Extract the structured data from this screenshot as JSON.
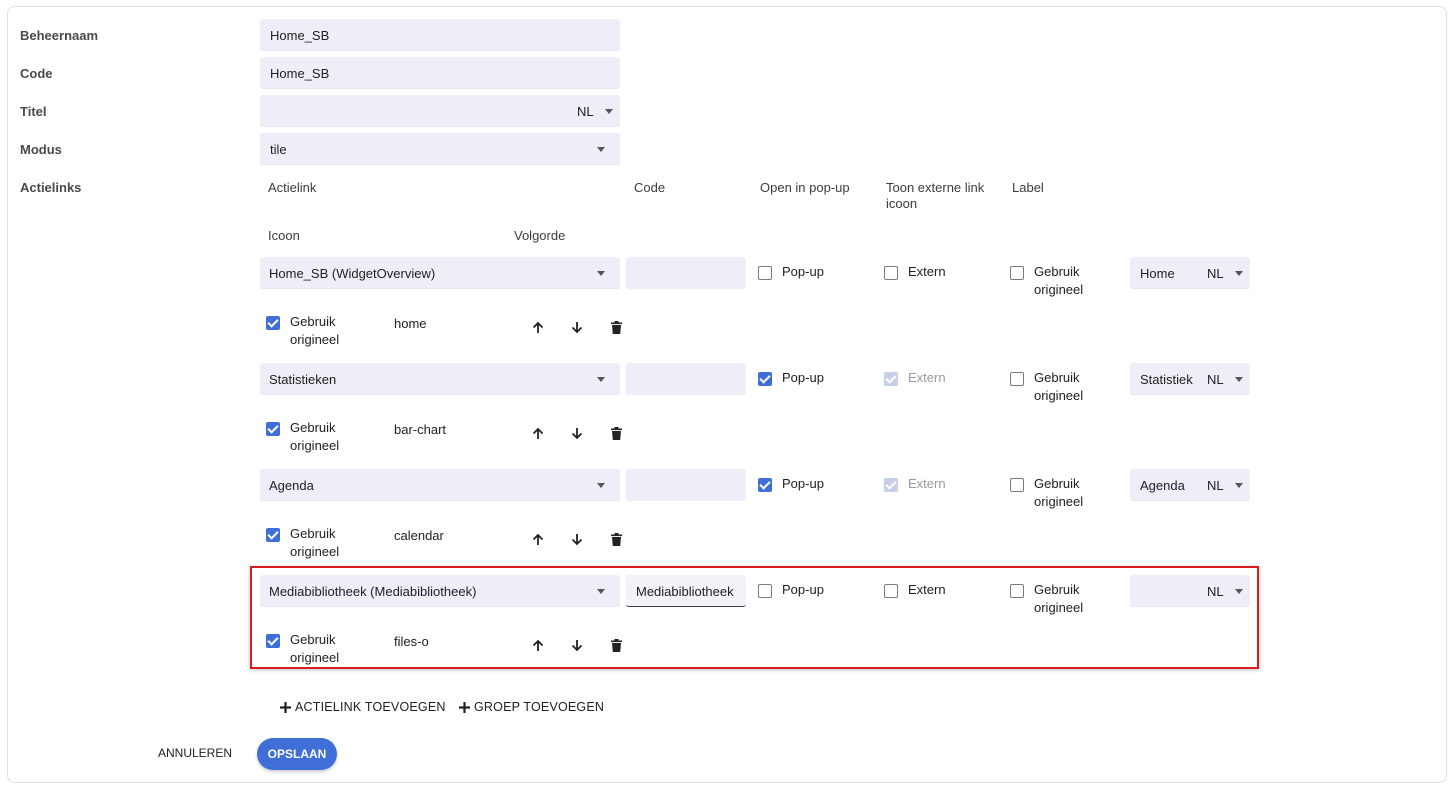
{
  "form": {
    "beheernaam": {
      "label": "Beheernaam",
      "value": "Home_SB"
    },
    "code": {
      "label": "Code",
      "value": "Home_SB"
    },
    "titel": {
      "label": "Titel",
      "value": "",
      "lang": "NL"
    },
    "modus": {
      "label": "Modus",
      "value": "tile"
    },
    "actielinks_label": "Actielinks"
  },
  "columns": {
    "actielink": "Actielink",
    "code": "Code",
    "popup": "Open in pop-up",
    "extern": "Toon externe link icoon",
    "label": "Label",
    "icoon": "Icoon",
    "volgorde": "Volgorde"
  },
  "rows": [
    {
      "actielink": "Home_SB (WidgetOverview)",
      "code": "",
      "popup_label": "Pop-up",
      "popup_checked": false,
      "extern_label": "Extern",
      "extern_checked": false,
      "extern_disabled": false,
      "label_use_original": "Gebruik origineel",
      "label_use_original_checked": false,
      "label_value": "Home",
      "label_lang": "NL",
      "icon_use_original": "Gebruik origineel",
      "icon_use_original_checked": true,
      "icon_value": "home"
    },
    {
      "actielink": "Statistieken",
      "code": "",
      "popup_label": "Pop-up",
      "popup_checked": true,
      "extern_label": "Extern",
      "extern_checked": true,
      "extern_disabled": true,
      "label_use_original": "Gebruik origineel",
      "label_use_original_checked": false,
      "label_value": "Statistiek",
      "label_lang": "NL",
      "icon_use_original": "Gebruik origineel",
      "icon_use_original_checked": true,
      "icon_value": "bar-chart"
    },
    {
      "actielink": "Agenda",
      "code": "",
      "popup_label": "Pop-up",
      "popup_checked": true,
      "extern_label": "Extern",
      "extern_checked": true,
      "extern_disabled": true,
      "label_use_original": "Gebruik origineel",
      "label_use_original_checked": false,
      "label_value": "Agenda",
      "label_lang": "NL",
      "icon_use_original": "Gebruik origineel",
      "icon_use_original_checked": true,
      "icon_value": "calendar"
    },
    {
      "actielink": "Mediabibliotheek (Mediabibliotheek)",
      "code": "Mediabibliotheek",
      "popup_label": "Pop-up",
      "popup_checked": false,
      "extern_label": "Extern",
      "extern_checked": false,
      "extern_disabled": false,
      "label_use_original": "Gebruik origineel",
      "label_use_original_checked": false,
      "label_value": "",
      "label_lang": "NL",
      "icon_use_original": "Gebruik origineel",
      "icon_use_original_checked": true,
      "icon_value": "files-o"
    }
  ],
  "actions": {
    "add_link": "ACTIELINK TOEVOEGEN",
    "add_group": "GROEP TOEVOEGEN",
    "cancel": "ANNULEREN",
    "save": "OPSLAAN"
  },
  "colors": {
    "accent": "#3f6fd6",
    "highlight": "#d81e1e",
    "field_bg": "#eeeef8"
  }
}
